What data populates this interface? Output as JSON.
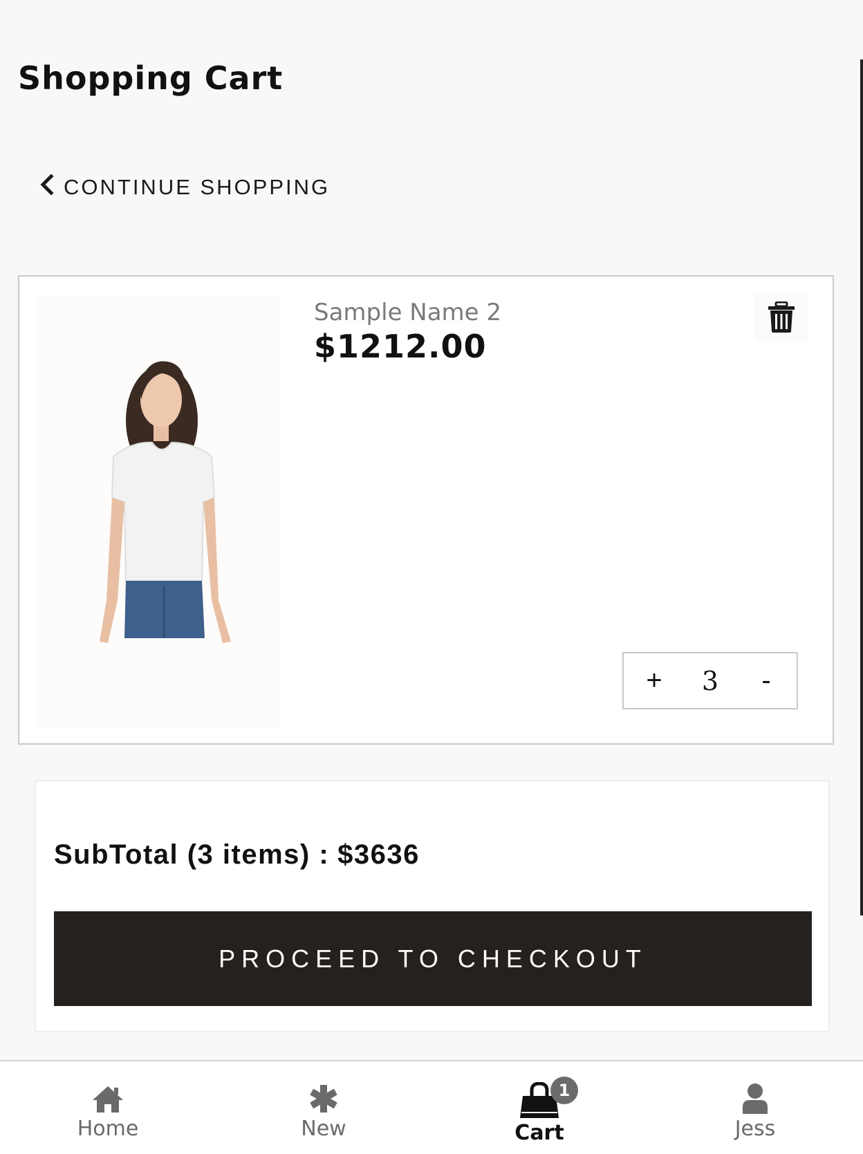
{
  "page": {
    "title": "Shopping Cart",
    "continue_label": "CONTINUE SHOPPING"
  },
  "cart_item": {
    "name": "Sample Name 2",
    "price": "$1212.00",
    "quantity": "3",
    "plus_label": "+",
    "minus_label": "-"
  },
  "summary": {
    "subtotal_label": "SubTotal (3 items) :",
    "subtotal_value": "$3636",
    "checkout_label": "PROCEED TO CHECKOUT"
  },
  "bottom_nav": {
    "items": [
      {
        "label": "Home",
        "icon": "home-icon"
      },
      {
        "label": "New",
        "icon": "asterisk-icon"
      },
      {
        "label": "Cart",
        "icon": "shopping-bag-icon",
        "active": true,
        "badge": "1"
      },
      {
        "label": "Jess",
        "icon": "user-icon"
      }
    ]
  },
  "colors": {
    "background": "#f9f8f7",
    "checkout_button": "#24211f",
    "badge": "#6b6b6b",
    "inactive_nav": "#6a6a6a"
  }
}
